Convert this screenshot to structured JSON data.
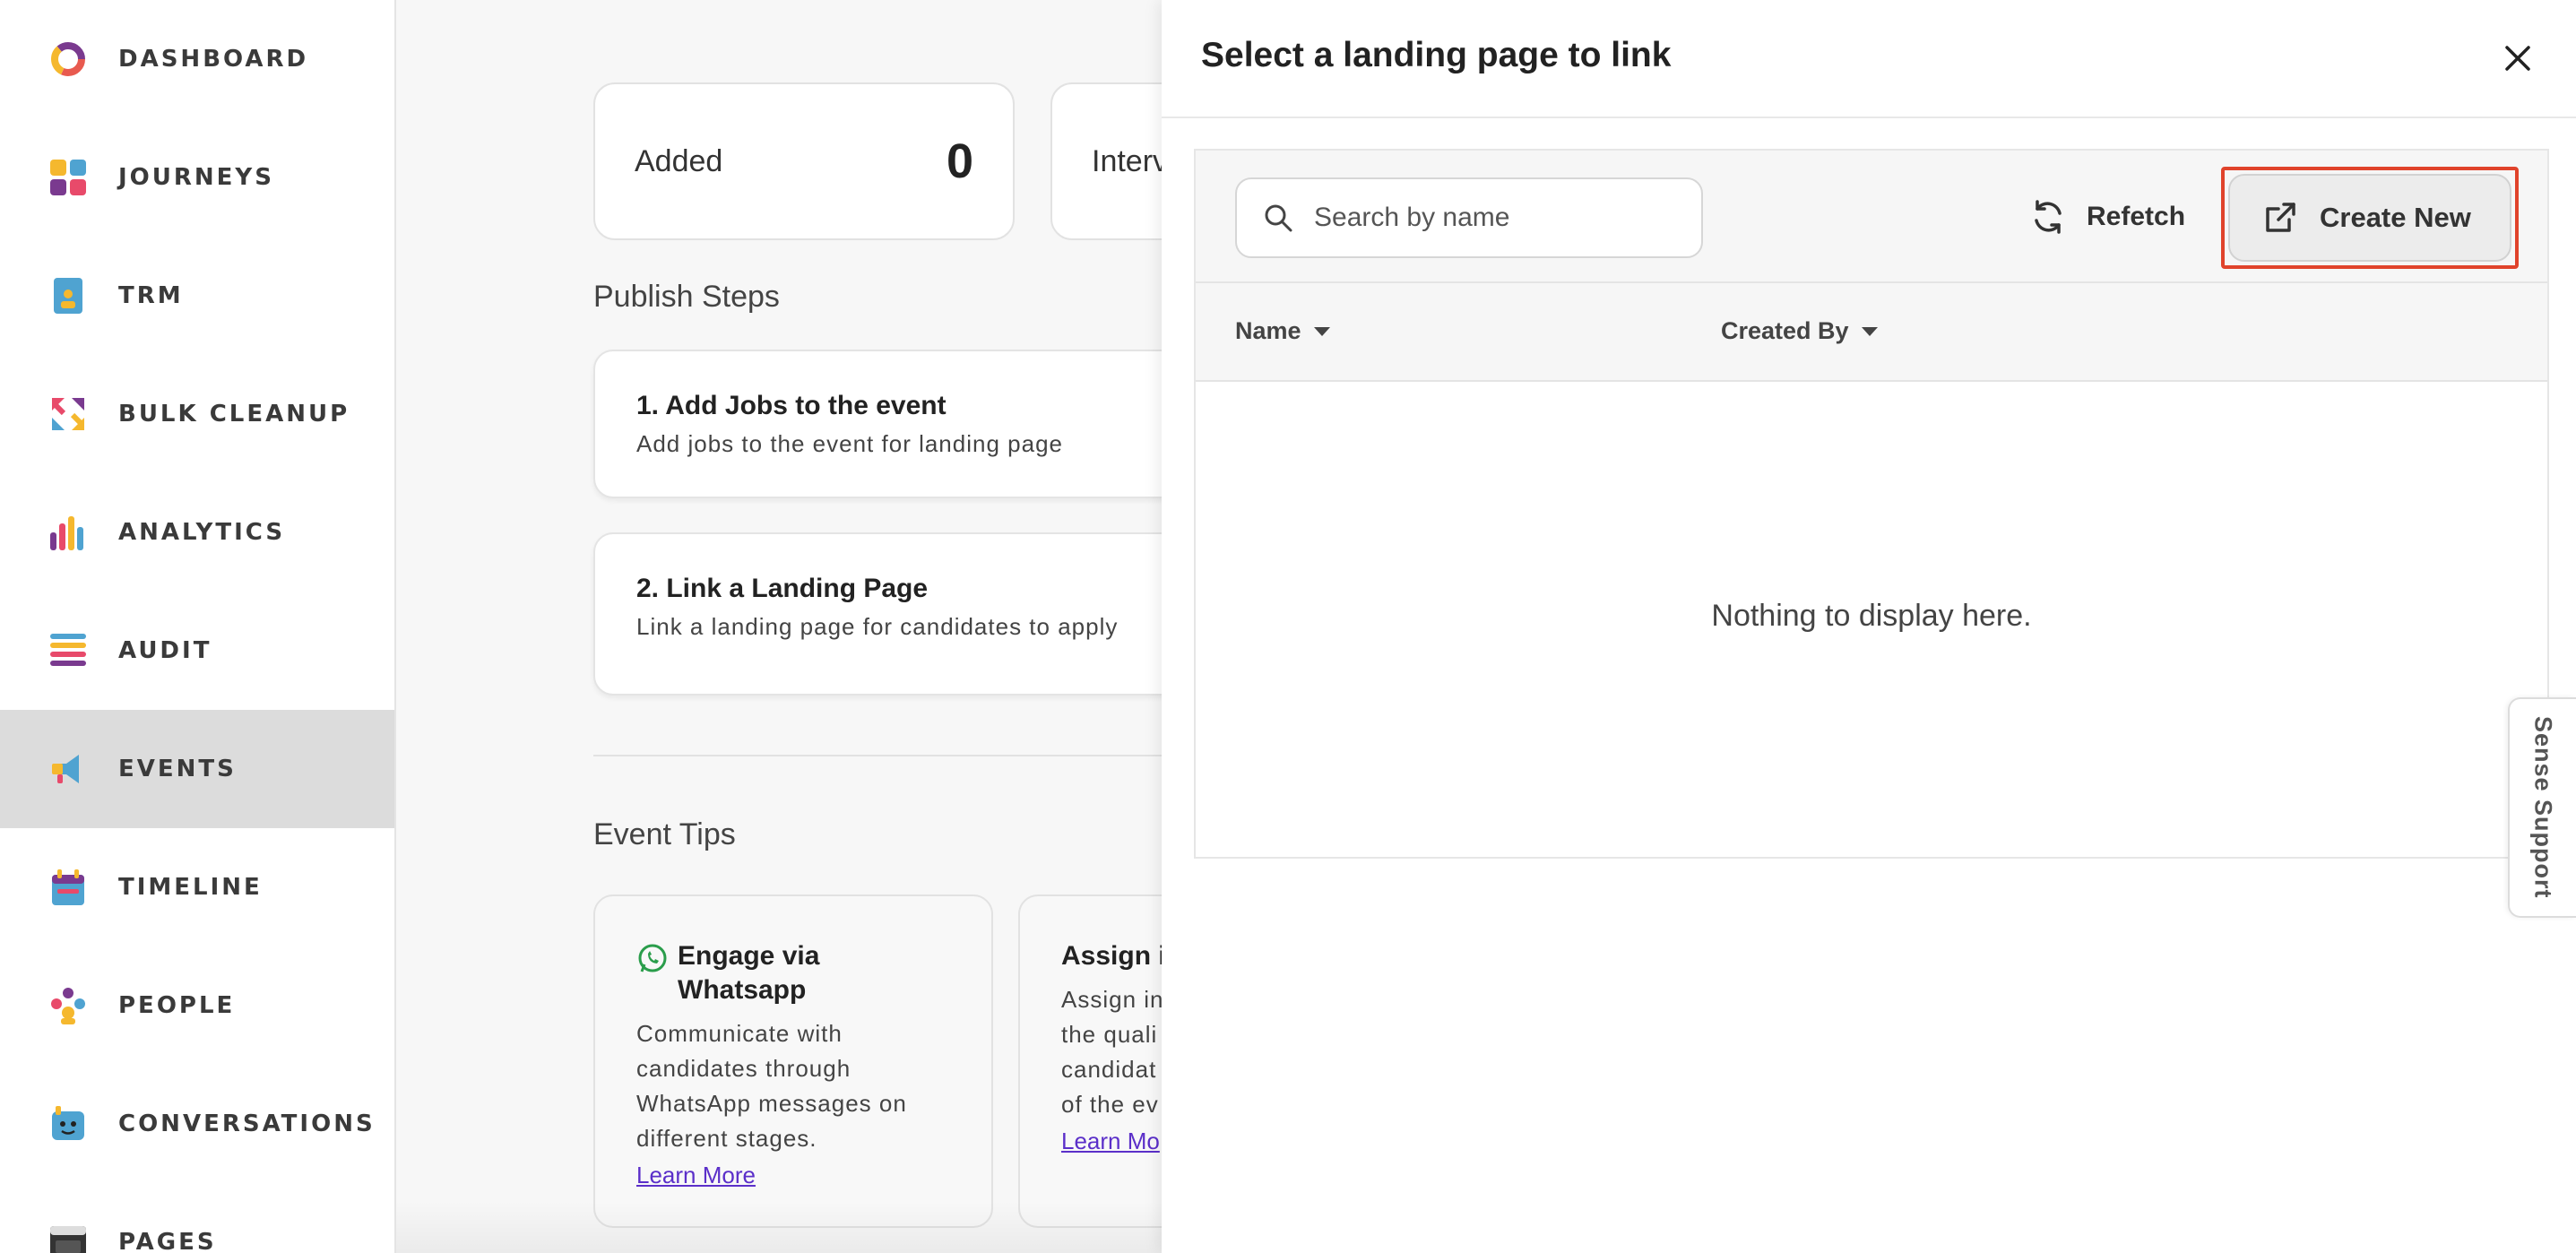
{
  "sidebar": {
    "items": [
      {
        "label": "DASHBOARD",
        "icon": "dashboard-ring-icon"
      },
      {
        "label": "JOURNEYS",
        "icon": "journeys-grid-icon"
      },
      {
        "label": "TRM",
        "icon": "trm-document-icon"
      },
      {
        "label": "BULK CLEANUP",
        "icon": "bulk-cleanup-arrows-icon"
      },
      {
        "label": "ANALYTICS",
        "icon": "analytics-bars-icon"
      },
      {
        "label": "AUDIT",
        "icon": "audit-list-icon"
      },
      {
        "label": "EVENTS",
        "icon": "events-megaphone-icon"
      },
      {
        "label": "TIMELINE",
        "icon": "timeline-calendar-icon"
      },
      {
        "label": "PEOPLE",
        "icon": "people-group-icon"
      },
      {
        "label": "CONVERSATIONS",
        "icon": "conversations-bot-icon"
      },
      {
        "label": "PAGES",
        "icon": "pages-browser-icon"
      }
    ],
    "active": "EVENTS"
  },
  "main": {
    "stats": [
      {
        "label": "Added",
        "value": "0"
      },
      {
        "label": "Interv"
      }
    ],
    "publish_steps_title": "Publish Steps",
    "steps": [
      {
        "title": "1. Add Jobs to the event",
        "desc": "Add jobs to the event for landing page"
      },
      {
        "title": "2. Link a Landing Page",
        "desc": "Link a landing page for candidates to apply"
      }
    ],
    "event_tips_title": "Event Tips",
    "tips": [
      {
        "title_line1": "Engage via",
        "title_line2": "Whatsapp",
        "desc_lines": [
          "Communicate with",
          "candidates through",
          "WhatsApp messages on",
          "different stages."
        ],
        "link": "Learn More",
        "icon": "whatsapp-icon"
      },
      {
        "title_line1": "Assign in",
        "desc_lines": [
          "Assign in",
          "the quali",
          "candidat",
          "of the ev"
        ],
        "link": "Learn Mo"
      }
    ]
  },
  "drawer": {
    "title": "Select a landing page to link",
    "search_placeholder": "Search by name",
    "refetch_label": "Refetch",
    "create_label": "Create New",
    "columns": [
      "Name",
      "Created By"
    ],
    "empty_message": "Nothing to display here."
  },
  "support": {
    "label": "Sense Support"
  },
  "colors": {
    "highlight": "#e0432b",
    "link": "#5b2fc9",
    "active_nav": "#dcdcdc"
  }
}
